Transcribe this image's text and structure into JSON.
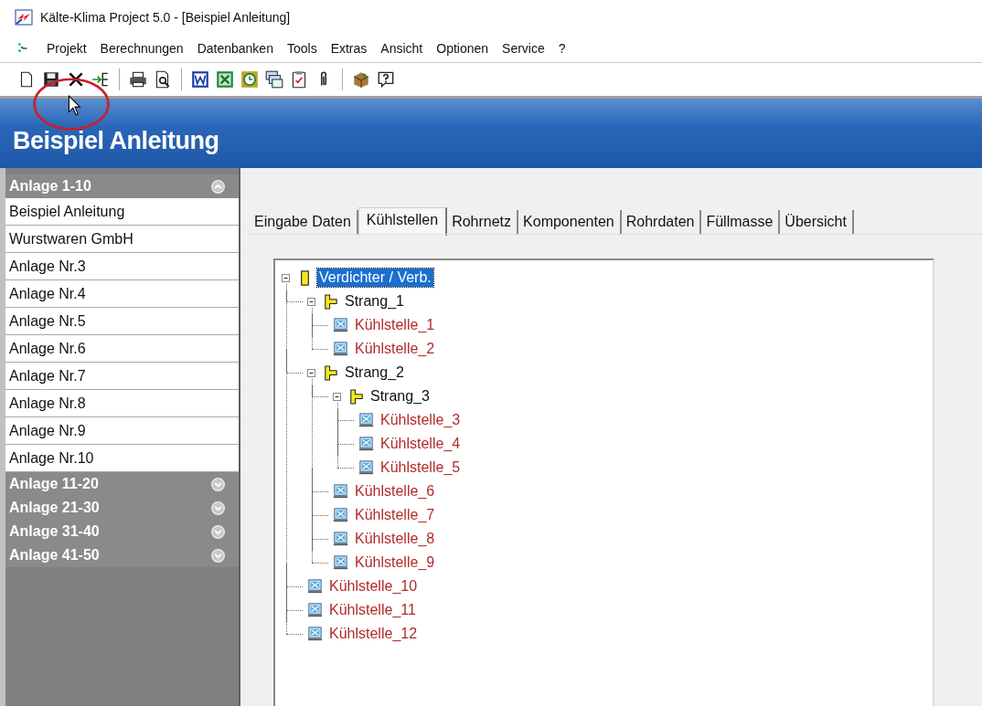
{
  "window": {
    "title": "Kälte-Klima Project 5.0 - [Beispiel Anleitung]"
  },
  "menu": [
    "Projekt",
    "Berechnungen",
    "Datenbanken",
    "Tools",
    "Extras",
    "Ansicht",
    "Optionen",
    "Service",
    "?"
  ],
  "toolbar": [
    {
      "kind": "new"
    },
    {
      "kind": "save"
    },
    {
      "kind": "delete"
    },
    {
      "kind": "export"
    },
    {
      "kind": "separator"
    },
    {
      "kind": "print"
    },
    {
      "kind": "preview"
    },
    {
      "kind": "separator"
    },
    {
      "kind": "word"
    },
    {
      "kind": "excel"
    },
    {
      "kind": "clock"
    },
    {
      "kind": "windows"
    },
    {
      "kind": "clipboard"
    },
    {
      "kind": "clip"
    },
    {
      "kind": "separator"
    },
    {
      "kind": "package"
    },
    {
      "kind": "help"
    }
  ],
  "header": {
    "title": "Beispiel Anleitung"
  },
  "sidebar": {
    "groups": [
      {
        "label": "Anlage 1-10",
        "expanded": true,
        "items": [
          {
            "label": "Beispiel Anleitung"
          },
          {
            "label": "Wurstwaren GmbH"
          },
          {
            "label": "Anlage Nr.3"
          },
          {
            "label": "Anlage Nr.4"
          },
          {
            "label": "Anlage Nr.5"
          },
          {
            "label": "Anlage Nr.6"
          },
          {
            "label": "Anlage Nr.7"
          },
          {
            "label": "Anlage Nr.8"
          },
          {
            "label": "Anlage Nr.9"
          },
          {
            "label": "Anlage Nr.10"
          }
        ]
      },
      {
        "label": "Anlage 11-20",
        "expanded": false
      },
      {
        "label": "Anlage 21-30",
        "expanded": false
      },
      {
        "label": "Anlage 31-40",
        "expanded": false
      },
      {
        "label": "Anlage 41-50",
        "expanded": false
      }
    ]
  },
  "tabs": [
    {
      "label": "Eingabe Daten",
      "selected": false
    },
    {
      "label": "Kühlstellen",
      "selected": true
    },
    {
      "label": "Rohrnetz",
      "selected": false
    },
    {
      "label": "Komponenten",
      "selected": false
    },
    {
      "label": "Rohrdaten",
      "selected": false
    },
    {
      "label": "Füllmasse",
      "selected": false
    },
    {
      "label": "Übersicht",
      "selected": false
    }
  ],
  "tree": [
    {
      "label": "Verdichter / Verb.",
      "kind": "compressor",
      "selected": true,
      "expanded": true,
      "children": [
        {
          "label": "Strang_1",
          "kind": "branch",
          "selected": false,
          "expanded": true,
          "children": [
            {
              "label": "Kühlstelle_1",
              "kind": "point",
              "selected": false
            },
            {
              "label": "Kühlstelle_2",
              "kind": "point",
              "selected": false
            }
          ]
        },
        {
          "label": "Strang_2",
          "kind": "branch",
          "selected": false,
          "expanded": true,
          "children": [
            {
              "label": "Strang_3",
              "kind": "branch",
              "selected": false,
              "expanded": true,
              "children": [
                {
                  "label": "Kühlstelle_3",
                  "kind": "point",
                  "selected": false
                },
                {
                  "label": "Kühlstelle_4",
                  "kind": "point",
                  "selected": false
                },
                {
                  "label": "Kühlstelle_5",
                  "kind": "point",
                  "selected": false
                }
              ]
            },
            {
              "label": "Kühlstelle_6",
              "kind": "point",
              "selected": false
            },
            {
              "label": "Kühlstelle_7",
              "kind": "point",
              "selected": false
            },
            {
              "label": "Kühlstelle_8",
              "kind": "point",
              "selected": false
            },
            {
              "label": "Kühlstelle_9",
              "kind": "point",
              "selected": false
            }
          ]
        },
        {
          "label": "Kühlstelle_10",
          "kind": "point",
          "selected": false
        },
        {
          "label": "Kühlstelle_11",
          "kind": "point",
          "selected": false
        },
        {
          "label": "Kühlstelle_12",
          "kind": "point",
          "selected": false
        }
      ]
    }
  ]
}
